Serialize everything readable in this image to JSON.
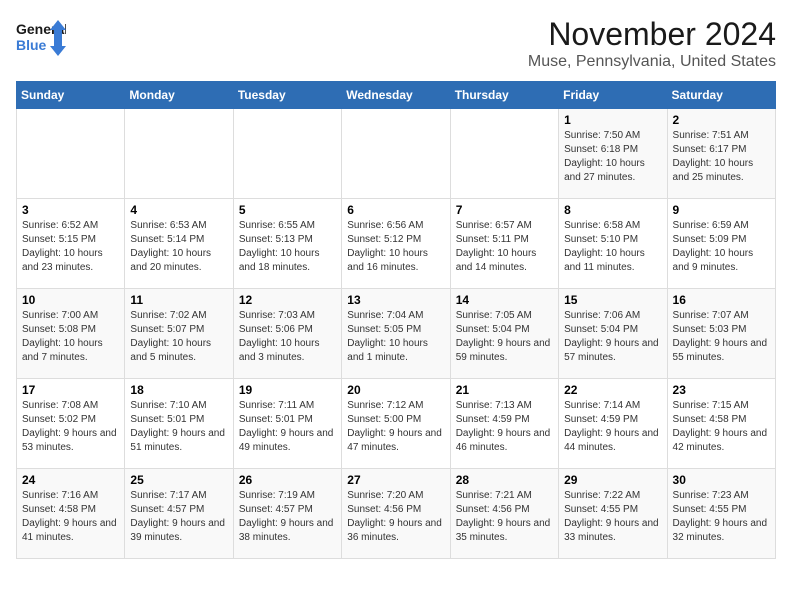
{
  "logo": {
    "line1": "General",
    "line2": "Blue"
  },
  "title": "November 2024",
  "location": "Muse, Pennsylvania, United States",
  "days_header": [
    "Sunday",
    "Monday",
    "Tuesday",
    "Wednesday",
    "Thursday",
    "Friday",
    "Saturday"
  ],
  "weeks": [
    [
      {
        "day": "",
        "info": ""
      },
      {
        "day": "",
        "info": ""
      },
      {
        "day": "",
        "info": ""
      },
      {
        "day": "",
        "info": ""
      },
      {
        "day": "",
        "info": ""
      },
      {
        "day": "1",
        "info": "Sunrise: 7:50 AM\nSunset: 6:18 PM\nDaylight: 10 hours and 27 minutes."
      },
      {
        "day": "2",
        "info": "Sunrise: 7:51 AM\nSunset: 6:17 PM\nDaylight: 10 hours and 25 minutes."
      }
    ],
    [
      {
        "day": "3",
        "info": "Sunrise: 6:52 AM\nSunset: 5:15 PM\nDaylight: 10 hours and 23 minutes."
      },
      {
        "day": "4",
        "info": "Sunrise: 6:53 AM\nSunset: 5:14 PM\nDaylight: 10 hours and 20 minutes."
      },
      {
        "day": "5",
        "info": "Sunrise: 6:55 AM\nSunset: 5:13 PM\nDaylight: 10 hours and 18 minutes."
      },
      {
        "day": "6",
        "info": "Sunrise: 6:56 AM\nSunset: 5:12 PM\nDaylight: 10 hours and 16 minutes."
      },
      {
        "day": "7",
        "info": "Sunrise: 6:57 AM\nSunset: 5:11 PM\nDaylight: 10 hours and 14 minutes."
      },
      {
        "day": "8",
        "info": "Sunrise: 6:58 AM\nSunset: 5:10 PM\nDaylight: 10 hours and 11 minutes."
      },
      {
        "day": "9",
        "info": "Sunrise: 6:59 AM\nSunset: 5:09 PM\nDaylight: 10 hours and 9 minutes."
      }
    ],
    [
      {
        "day": "10",
        "info": "Sunrise: 7:00 AM\nSunset: 5:08 PM\nDaylight: 10 hours and 7 minutes."
      },
      {
        "day": "11",
        "info": "Sunrise: 7:02 AM\nSunset: 5:07 PM\nDaylight: 10 hours and 5 minutes."
      },
      {
        "day": "12",
        "info": "Sunrise: 7:03 AM\nSunset: 5:06 PM\nDaylight: 10 hours and 3 minutes."
      },
      {
        "day": "13",
        "info": "Sunrise: 7:04 AM\nSunset: 5:05 PM\nDaylight: 10 hours and 1 minute."
      },
      {
        "day": "14",
        "info": "Sunrise: 7:05 AM\nSunset: 5:04 PM\nDaylight: 9 hours and 59 minutes."
      },
      {
        "day": "15",
        "info": "Sunrise: 7:06 AM\nSunset: 5:04 PM\nDaylight: 9 hours and 57 minutes."
      },
      {
        "day": "16",
        "info": "Sunrise: 7:07 AM\nSunset: 5:03 PM\nDaylight: 9 hours and 55 minutes."
      }
    ],
    [
      {
        "day": "17",
        "info": "Sunrise: 7:08 AM\nSunset: 5:02 PM\nDaylight: 9 hours and 53 minutes."
      },
      {
        "day": "18",
        "info": "Sunrise: 7:10 AM\nSunset: 5:01 PM\nDaylight: 9 hours and 51 minutes."
      },
      {
        "day": "19",
        "info": "Sunrise: 7:11 AM\nSunset: 5:01 PM\nDaylight: 9 hours and 49 minutes."
      },
      {
        "day": "20",
        "info": "Sunrise: 7:12 AM\nSunset: 5:00 PM\nDaylight: 9 hours and 47 minutes."
      },
      {
        "day": "21",
        "info": "Sunrise: 7:13 AM\nSunset: 4:59 PM\nDaylight: 9 hours and 46 minutes."
      },
      {
        "day": "22",
        "info": "Sunrise: 7:14 AM\nSunset: 4:59 PM\nDaylight: 9 hours and 44 minutes."
      },
      {
        "day": "23",
        "info": "Sunrise: 7:15 AM\nSunset: 4:58 PM\nDaylight: 9 hours and 42 minutes."
      }
    ],
    [
      {
        "day": "24",
        "info": "Sunrise: 7:16 AM\nSunset: 4:58 PM\nDaylight: 9 hours and 41 minutes."
      },
      {
        "day": "25",
        "info": "Sunrise: 7:17 AM\nSunset: 4:57 PM\nDaylight: 9 hours and 39 minutes."
      },
      {
        "day": "26",
        "info": "Sunrise: 7:19 AM\nSunset: 4:57 PM\nDaylight: 9 hours and 38 minutes."
      },
      {
        "day": "27",
        "info": "Sunrise: 7:20 AM\nSunset: 4:56 PM\nDaylight: 9 hours and 36 minutes."
      },
      {
        "day": "28",
        "info": "Sunrise: 7:21 AM\nSunset: 4:56 PM\nDaylight: 9 hours and 35 minutes."
      },
      {
        "day": "29",
        "info": "Sunrise: 7:22 AM\nSunset: 4:55 PM\nDaylight: 9 hours and 33 minutes."
      },
      {
        "day": "30",
        "info": "Sunrise: 7:23 AM\nSunset: 4:55 PM\nDaylight: 9 hours and 32 minutes."
      }
    ]
  ]
}
